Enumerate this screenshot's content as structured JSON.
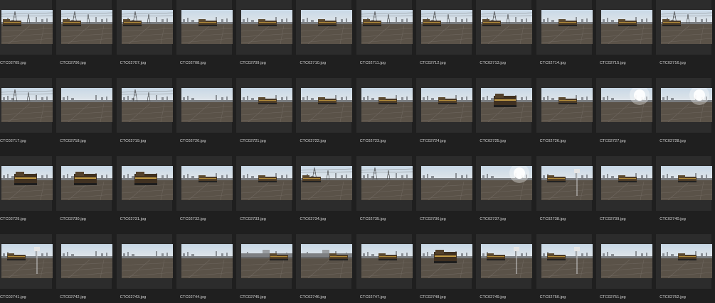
{
  "app": {
    "view": "thumbnail-grid",
    "background": "#1f1f1f",
    "thumbnail_bg": "#2c2c2c",
    "label_color": "#d7d7d7"
  },
  "files": [
    {
      "name": "CTC02705.jpg",
      "scene": "towers-train"
    },
    {
      "name": "CTC02706.jpg",
      "scene": "towers-train"
    },
    {
      "name": "CTC02707.jpg",
      "scene": "towers-train"
    },
    {
      "name": "CTC02708.jpg",
      "scene": "train-wide"
    },
    {
      "name": "CTC02709.jpg",
      "scene": "train-wide"
    },
    {
      "name": "CTC02710.jpg",
      "scene": "train-wide"
    },
    {
      "name": "CTC02711.jpg",
      "scene": "towers-train"
    },
    {
      "name": "CTC02712.jpg",
      "scene": "towers-train"
    },
    {
      "name": "CTC02713.jpg",
      "scene": "towers-train"
    },
    {
      "name": "CTC02714.jpg",
      "scene": "train-wide"
    },
    {
      "name": "CTC02715.jpg",
      "scene": "train-wide"
    },
    {
      "name": "CTC02716.jpg",
      "scene": "towers-train"
    },
    {
      "name": "CTC02717.jpg",
      "scene": "towers-city"
    },
    {
      "name": "CTC02718.jpg",
      "scene": "city"
    },
    {
      "name": "CTC02719.jpg",
      "scene": "towers-city"
    },
    {
      "name": "CTC02720.jpg",
      "scene": "city"
    },
    {
      "name": "CTC02721.jpg",
      "scene": "train-wide"
    },
    {
      "name": "CTC02722.jpg",
      "scene": "train-wide"
    },
    {
      "name": "CTC02723.jpg",
      "scene": "train-wide"
    },
    {
      "name": "CTC02724.jpg",
      "scene": "train-wide"
    },
    {
      "name": "CTC02725.jpg",
      "scene": "train-close"
    },
    {
      "name": "CTC02726.jpg",
      "scene": "train-wide"
    },
    {
      "name": "CTC02727.jpg",
      "scene": "sun"
    },
    {
      "name": "CTC02728.jpg",
      "scene": "sun"
    },
    {
      "name": "CTC02729.jpg",
      "scene": "train-close"
    },
    {
      "name": "CTC02730.jpg",
      "scene": "train-close"
    },
    {
      "name": "CTC02731.jpg",
      "scene": "train-close"
    },
    {
      "name": "CTC02732.jpg",
      "scene": "train-wide"
    },
    {
      "name": "CTC02733.jpg",
      "scene": "train-wide"
    },
    {
      "name": "CTC02734.jpg",
      "scene": "towers-train"
    },
    {
      "name": "CTC02735.jpg",
      "scene": "towers-city"
    },
    {
      "name": "CTC02736.jpg",
      "scene": "city"
    },
    {
      "name": "CTC02737.jpg",
      "scene": "sun"
    },
    {
      "name": "CTC02738.jpg",
      "scene": "sign"
    },
    {
      "name": "CTC02739.jpg",
      "scene": "train-wide"
    },
    {
      "name": "CTC02740.jpg",
      "scene": "train-wide"
    },
    {
      "name": "CTC02741.jpg",
      "scene": "sign"
    },
    {
      "name": "CTC02742.jpg",
      "scene": "city"
    },
    {
      "name": "CTC02743.jpg",
      "scene": "city"
    },
    {
      "name": "CTC02744.jpg",
      "scene": "city"
    },
    {
      "name": "CTC02745.jpg",
      "scene": "bridge"
    },
    {
      "name": "CTC02746.jpg",
      "scene": "bridge"
    },
    {
      "name": "CTC02747.jpg",
      "scene": "train-wide"
    },
    {
      "name": "CTC02748.jpg",
      "scene": "train-close"
    },
    {
      "name": "CTC02749.jpg",
      "scene": "sign"
    },
    {
      "name": "CTC02750.jpg",
      "scene": "sign"
    },
    {
      "name": "CTC02751.jpg",
      "scene": "city"
    },
    {
      "name": "CTC02752.jpg",
      "scene": "train-wide"
    }
  ]
}
